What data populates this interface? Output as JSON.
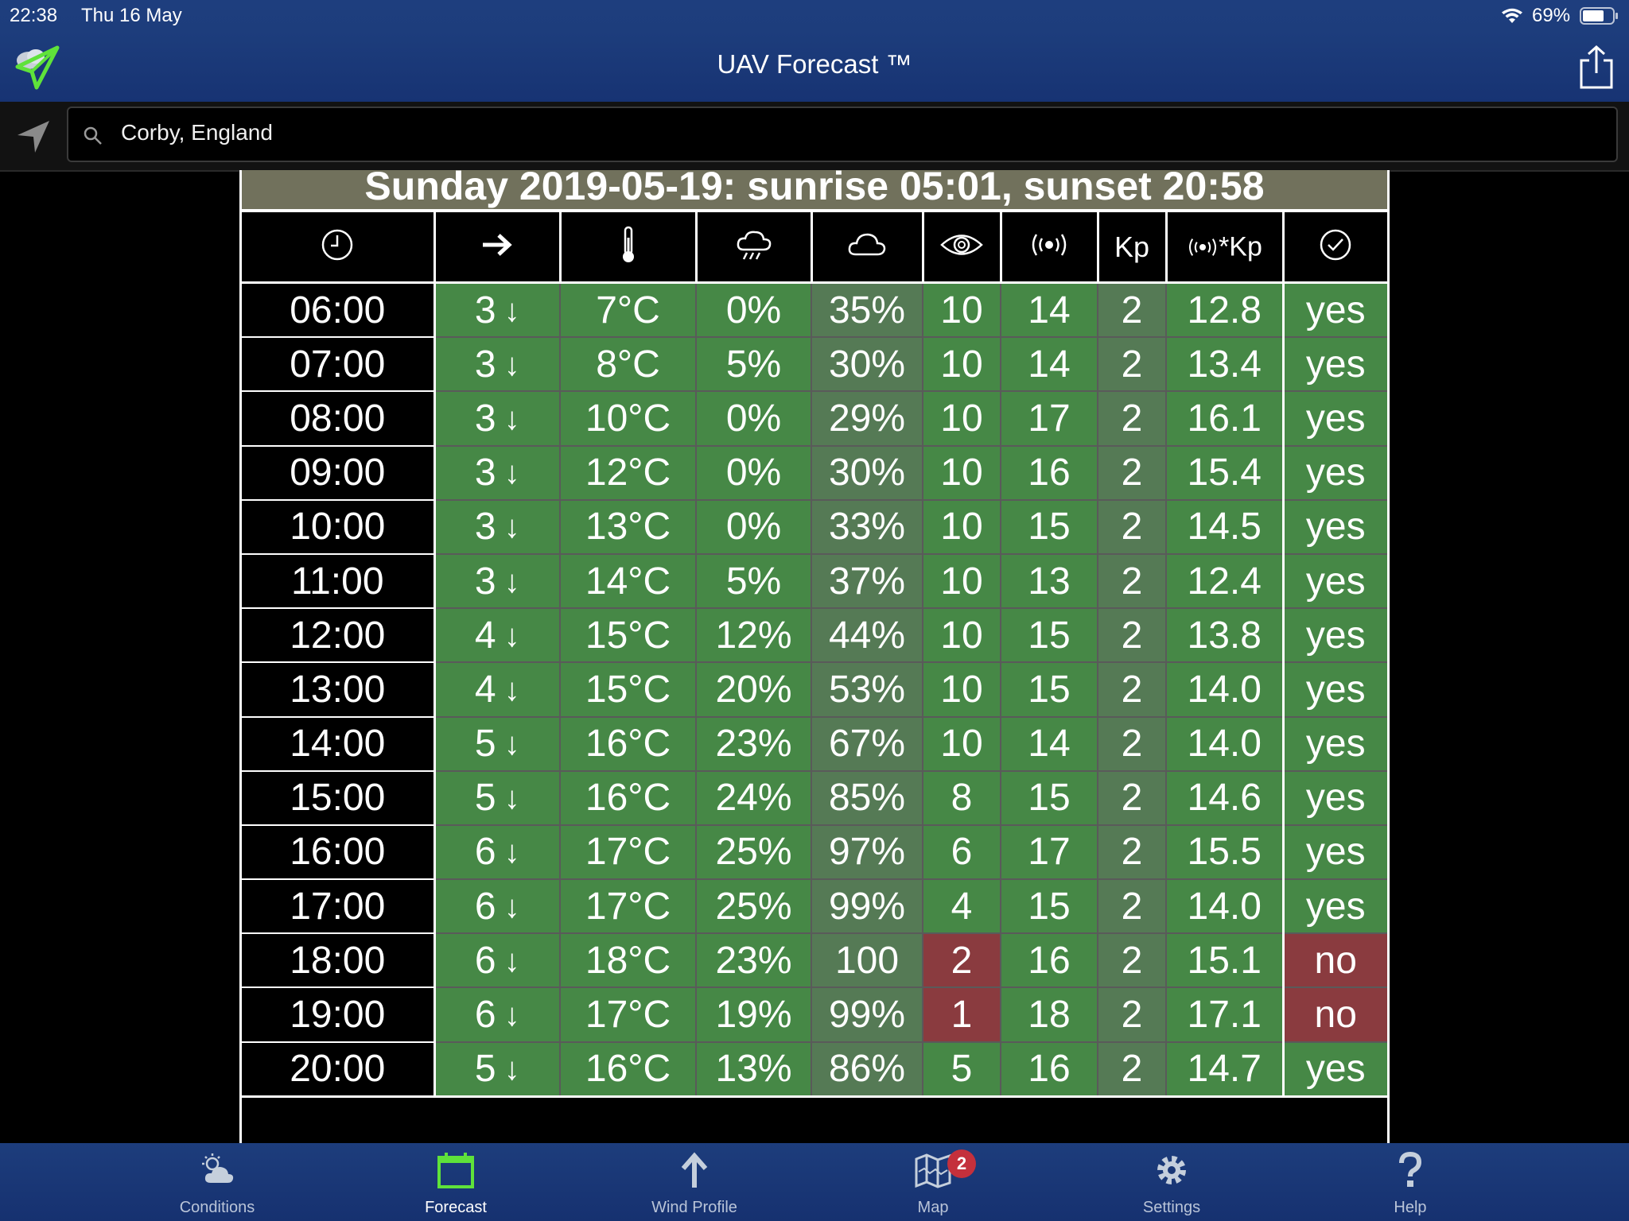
{
  "status_bar": {
    "time": "22:38",
    "date": "Thu 16 May",
    "battery": "69%"
  },
  "app": {
    "title": "UAV Forecast ™"
  },
  "search": {
    "value": "Corby, England"
  },
  "forecast": {
    "day_header": "Sunday 2019-05-19: sunrise 05:01, sunset 20:58",
    "column_icons": [
      "clock-icon",
      "wind-direction-icon",
      "thermometer-icon",
      "rain-cloud-icon",
      "cloud-icon",
      "eye-icon",
      "satellite-signal-icon",
      "",
      "satellite-signal-icon",
      "checkmark-circle-icon"
    ],
    "kp_label": "Kp",
    "rkp_label": "*Kp",
    "rows": [
      {
        "time": "06:00",
        "wind": "3",
        "temp": "7°C",
        "precip": "0%",
        "cloud": "35%",
        "vis": "10",
        "sats": "14",
        "kp": "2",
        "ratio": "12.8",
        "fly": "yes"
      },
      {
        "time": "07:00",
        "wind": "3",
        "temp": "8°C",
        "precip": "5%",
        "cloud": "30%",
        "vis": "10",
        "sats": "14",
        "kp": "2",
        "ratio": "13.4",
        "fly": "yes"
      },
      {
        "time": "08:00",
        "wind": "3",
        "temp": "10°C",
        "precip": "0%",
        "cloud": "29%",
        "vis": "10",
        "sats": "17",
        "kp": "2",
        "ratio": "16.1",
        "fly": "yes"
      },
      {
        "time": "09:00",
        "wind": "3",
        "temp": "12°C",
        "precip": "0%",
        "cloud": "30%",
        "vis": "10",
        "sats": "16",
        "kp": "2",
        "ratio": "15.4",
        "fly": "yes"
      },
      {
        "time": "10:00",
        "wind": "3",
        "temp": "13°C",
        "precip": "0%",
        "cloud": "33%",
        "vis": "10",
        "sats": "15",
        "kp": "2",
        "ratio": "14.5",
        "fly": "yes"
      },
      {
        "time": "11:00",
        "wind": "3",
        "temp": "14°C",
        "precip": "5%",
        "cloud": "37%",
        "vis": "10",
        "sats": "13",
        "kp": "2",
        "ratio": "12.4",
        "fly": "yes"
      },
      {
        "time": "12:00",
        "wind": "4",
        "temp": "15°C",
        "precip": "12%",
        "cloud": "44%",
        "vis": "10",
        "sats": "15",
        "kp": "2",
        "ratio": "13.8",
        "fly": "yes"
      },
      {
        "time": "13:00",
        "wind": "4",
        "temp": "15°C",
        "precip": "20%",
        "cloud": "53%",
        "vis": "10",
        "sats": "15",
        "kp": "2",
        "ratio": "14.0",
        "fly": "yes"
      },
      {
        "time": "14:00",
        "wind": "5",
        "temp": "16°C",
        "precip": "23%",
        "cloud": "67%",
        "vis": "10",
        "sats": "14",
        "kp": "2",
        "ratio": "14.0",
        "fly": "yes"
      },
      {
        "time": "15:00",
        "wind": "5",
        "temp": "16°C",
        "precip": "24%",
        "cloud": "85%",
        "vis": "8",
        "sats": "15",
        "kp": "2",
        "ratio": "14.6",
        "fly": "yes"
      },
      {
        "time": "16:00",
        "wind": "6",
        "temp": "17°C",
        "precip": "25%",
        "cloud": "97%",
        "vis": "6",
        "sats": "17",
        "kp": "2",
        "ratio": "15.5",
        "fly": "yes"
      },
      {
        "time": "17:00",
        "wind": "6",
        "temp": "17°C",
        "precip": "25%",
        "cloud": "99%",
        "vis": "4",
        "sats": "15",
        "kp": "2",
        "ratio": "14.0",
        "fly": "yes"
      },
      {
        "time": "18:00",
        "wind": "6",
        "temp": "18°C",
        "precip": "23%",
        "cloud": "100",
        "vis": "2",
        "sats": "16",
        "kp": "2",
        "ratio": "15.1",
        "fly": "no"
      },
      {
        "time": "19:00",
        "wind": "6",
        "temp": "17°C",
        "precip": "19%",
        "cloud": "99%",
        "vis": "1",
        "sats": "18",
        "kp": "2",
        "ratio": "17.1",
        "fly": "no"
      },
      {
        "time": "20:00",
        "wind": "5",
        "temp": "16°C",
        "precip": "13%",
        "cloud": "86%",
        "vis": "5",
        "sats": "16",
        "kp": "2",
        "ratio": "14.7",
        "fly": "yes"
      }
    ]
  },
  "tabs": [
    {
      "label": "Conditions",
      "icon": "partly-cloudy-icon",
      "active": false
    },
    {
      "label": "Forecast",
      "icon": "calendar-icon",
      "active": true
    },
    {
      "label": "Wind Profile",
      "icon": "up-arrow-icon",
      "active": false
    },
    {
      "label": "Map",
      "icon": "map-icon",
      "active": false,
      "badge": "2"
    },
    {
      "label": "Settings",
      "icon": "gear-icon",
      "active": false
    },
    {
      "label": "Help",
      "icon": "question-mark-icon",
      "active": false
    }
  ],
  "colors": {
    "ok": "#468846",
    "dim_ok": "#557a55",
    "bad": "#8a3b3f",
    "header": "#71715c",
    "nav": "#1d3d7c"
  }
}
